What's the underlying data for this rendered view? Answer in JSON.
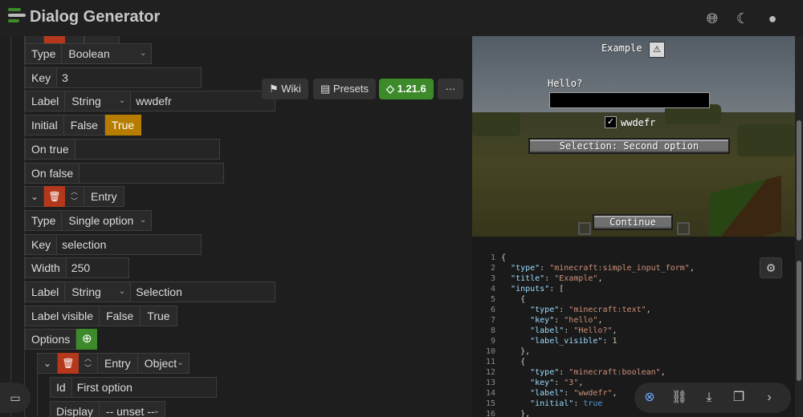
{
  "header": {
    "title": "Dialog Generator",
    "icons": [
      "globe-icon",
      "moon-icon",
      "github-icon"
    ]
  },
  "toolbar": {
    "wiki_label": "Wiki",
    "presets_label": "Presets",
    "version_label": "1.21.6",
    "more_label": "···"
  },
  "form": {
    "type_label": "Type",
    "type_value_boolean": "Boolean",
    "key_label": "Key",
    "key_value_3": "3",
    "label_label": "Label",
    "label_kind": "String",
    "label_value_wwdefr": "wwdefr",
    "initial_label": "Initial",
    "false_label": "False",
    "true_label": "True",
    "on_true_label": "On true",
    "on_false_label": "On false",
    "entry_label": "Entry",
    "type_value_single": "Single option",
    "key_value_selection": "selection",
    "width_label": "Width",
    "width_value": "250",
    "label_value_selection": "Selection",
    "label_visible_label": "Label visible",
    "options_label": "Options",
    "entry_kind": "Object",
    "id_label": "Id",
    "id_value": "First option",
    "display_label": "Display",
    "display_value": "-- unset --"
  },
  "preview": {
    "title": "Example",
    "input_label": "Hello?",
    "checkbox_label": "wwdefr",
    "selection_button": "Selection: Second option",
    "continue_button": "Continue"
  },
  "code": {
    "line_numbers": [
      "1",
      "2",
      "3",
      "4",
      "5",
      "6",
      "7",
      "8",
      "9",
      "10",
      "11",
      "12",
      "13",
      "14",
      "15",
      "16"
    ]
  },
  "colors": {
    "accent_true": "#b67d00",
    "delete_red": "#b5381c",
    "add_green": "#3c8a2a",
    "version_green": "#3c8a2a"
  }
}
